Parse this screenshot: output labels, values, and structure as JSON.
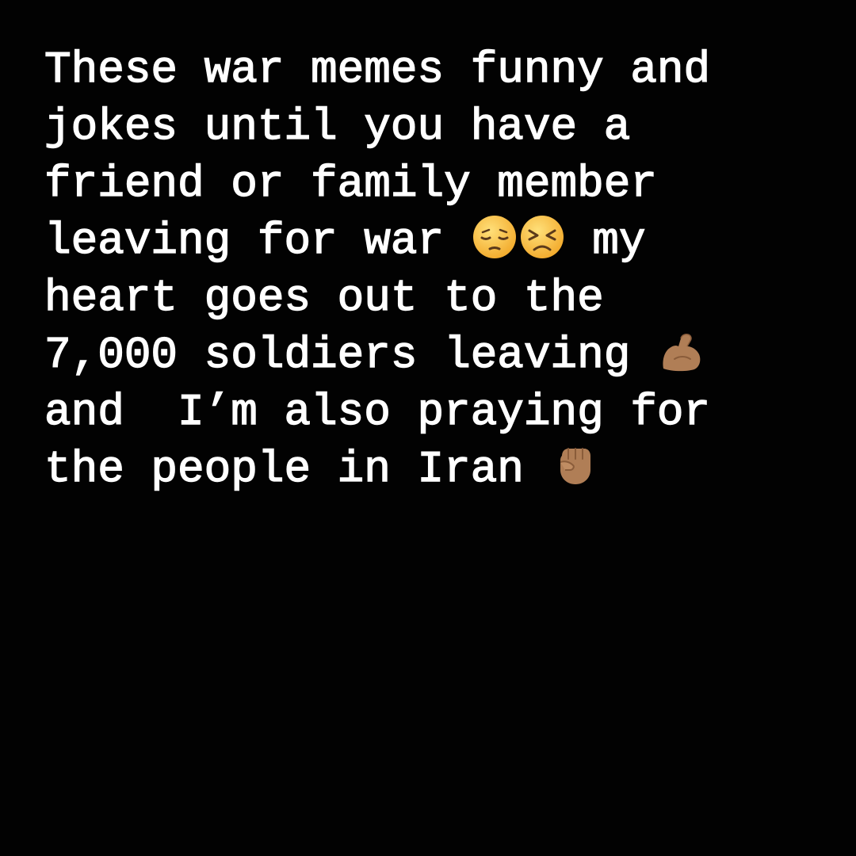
{
  "lines": [
    {
      "text": "These war memes funny and"
    },
    {
      "text": "jokes until you have a"
    },
    {
      "text": "friend or family member"
    },
    {
      "before": "leaving for war ",
      "after": " my"
    },
    {
      "text": "heart goes out to the"
    },
    {
      "before": "7,000 soldiers leaving ",
      "after": ""
    },
    {
      "text": "and  I’m also praying for"
    },
    {
      "before": "the people in Iran ",
      "after": ""
    }
  ],
  "emojis": {
    "pensive": "pensive-face-icon",
    "persevering": "persevering-face-icon",
    "flexed_biceps": "flexed-biceps-icon",
    "raised_fist": "raised-fist-icon"
  },
  "colors": {
    "background": "#020202",
    "text": "#ffffff",
    "emoji_face": "#f7c13e",
    "skin_tone": "#b07e56"
  }
}
